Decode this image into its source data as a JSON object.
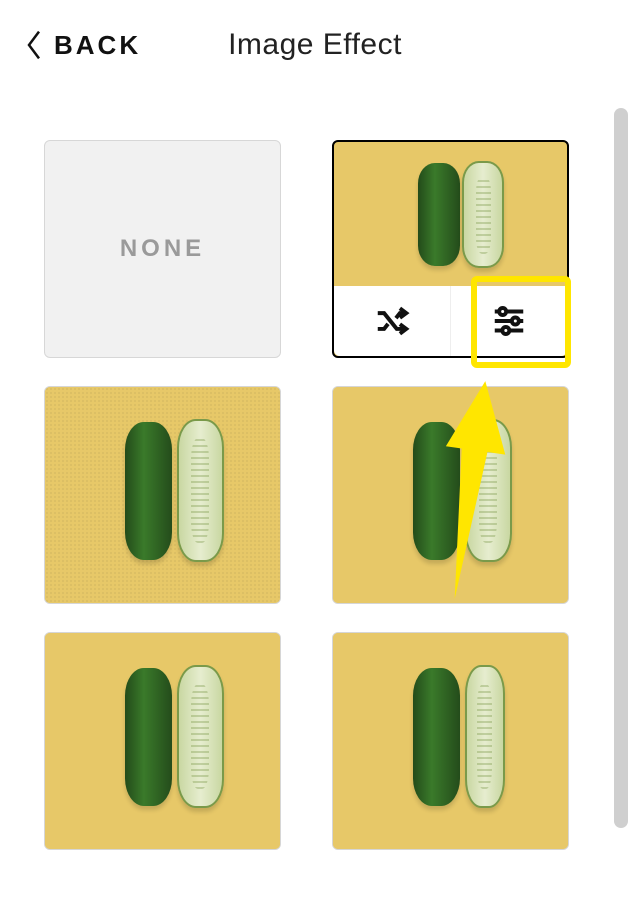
{
  "header": {
    "back_label": "BACK",
    "title": "Image Effect"
  },
  "tiles": {
    "none_label": "NONE"
  },
  "colors": {
    "highlight": "#ffe600"
  },
  "icons": {
    "back": "chevron-left-icon",
    "shuffle": "shuffle-icon",
    "sliders": "sliders-icon"
  }
}
